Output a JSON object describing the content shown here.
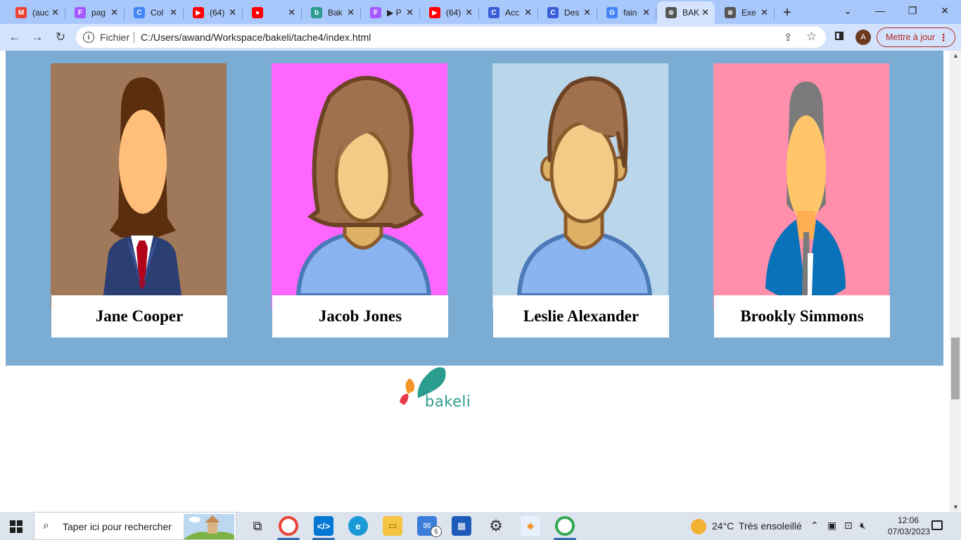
{
  "browser": {
    "tabs": [
      {
        "label": "(auc",
        "favicon": "gmail-icon",
        "color": "#ea4335",
        "glyph": "M"
      },
      {
        "label": "pag",
        "favicon": "figma-icon",
        "color": "#a259ff",
        "glyph": "F"
      },
      {
        "label": "Col",
        "favicon": "google-icon",
        "color": "#4285f4",
        "glyph": "C"
      },
      {
        "label": "(64)",
        "favicon": "youtube-icon",
        "color": "#ff0000",
        "glyph": "▶"
      },
      {
        "label": "",
        "favicon": "youtube-record-icon",
        "color": "#ff0000",
        "glyph": "●"
      },
      {
        "label": "Bak",
        "favicon": "bakeli-icon",
        "color": "#2a9d8f",
        "glyph": "b"
      },
      {
        "label": "▶ P",
        "favicon": "figma-icon",
        "color": "#a259ff",
        "glyph": "F"
      },
      {
        "label": "(64)",
        "favicon": "youtube-icon",
        "color": "#ff0000",
        "glyph": "▶"
      },
      {
        "label": "Acc",
        "favicon": "canva-icon",
        "color": "#3b5ed8",
        "glyph": "C"
      },
      {
        "label": "Des",
        "favicon": "canva-icon",
        "color": "#3b5ed8",
        "glyph": "C"
      },
      {
        "label": "fain",
        "favicon": "google-icon",
        "color": "#4285f4",
        "glyph": "G"
      },
      {
        "label": "BAK",
        "favicon": "globe-icon",
        "color": "#555555",
        "glyph": "⊕",
        "active": true
      },
      {
        "label": "Exe",
        "favicon": "globe-icon",
        "color": "#555555",
        "glyph": "⊕"
      }
    ],
    "new_tab": "+",
    "address": {
      "scheme_label": "Fichier",
      "url": "C:/Users/awand/Workspace/bakeli/tache4/index.html"
    },
    "profile_initial": "A",
    "update_label": "Mettre à jour"
  },
  "page": {
    "team": [
      {
        "name": "Jane Cooper",
        "bg": "#a0785a"
      },
      {
        "name": "Jacob Jones",
        "bg": "#ff66ff"
      },
      {
        "name": "Leslie Alexander",
        "bg": "#bad6ea"
      },
      {
        "name": "Brookly Simmons",
        "bg": "#ff8fab"
      }
    ],
    "logo_text": "bakeli"
  },
  "taskbar": {
    "search_placeholder": "Taper ici pour rechercher",
    "mail_badge": "5",
    "weather_temp": "24°C",
    "weather_desc": "Très ensoleillé",
    "time": "12:06",
    "date": "07/03/2023"
  }
}
